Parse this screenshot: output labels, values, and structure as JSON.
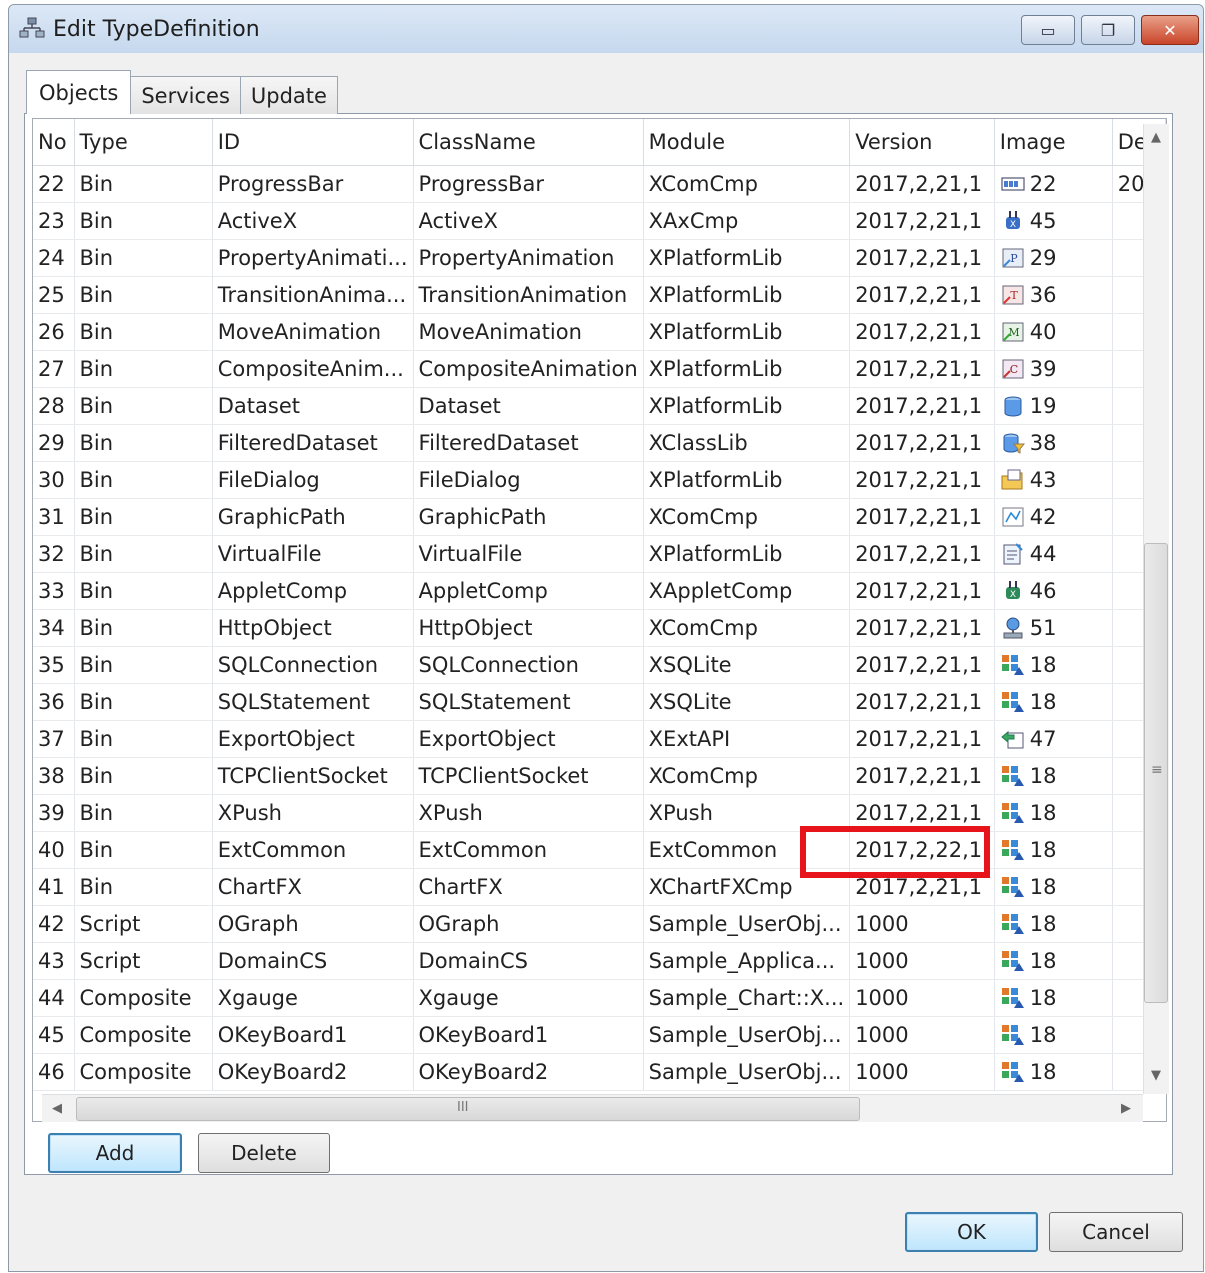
{
  "window": {
    "title": "Edit TypeDefinition",
    "accent": "#c9452a"
  },
  "tabs": [
    {
      "label": "Objects",
      "active": true
    },
    {
      "label": "Services",
      "active": false
    },
    {
      "label": "Update",
      "active": false
    }
  ],
  "grid": {
    "columns": [
      "No",
      "Type",
      "ID",
      "ClassName",
      "Module",
      "Version",
      "Image",
      "De"
    ],
    "rows": [
      {
        "no": "22",
        "type": "Bin",
        "id": "ProgressBar",
        "class": "ProgressBar",
        "module": "XComCmp",
        "version": "2017,2,21,1",
        "icon": "progressbar-icon",
        "image": "22",
        "de": "20"
      },
      {
        "no": "23",
        "type": "Bin",
        "id": "ActiveX",
        "class": "ActiveX",
        "module": "XAxCmp",
        "version": "2017,2,21,1",
        "icon": "activex-plug-icon",
        "image": "45",
        "de": ""
      },
      {
        "no": "24",
        "type": "Bin",
        "id": "PropertyAnimati...",
        "class": "PropertyAnimation",
        "module": "XPlatformLib",
        "version": "2017,2,21,1",
        "icon": "property-animation-icon",
        "image": "29",
        "de": ""
      },
      {
        "no": "25",
        "type": "Bin",
        "id": "TransitionAnima...",
        "class": "TransitionAnimation",
        "module": "XPlatformLib",
        "version": "2017,2,21,1",
        "icon": "transition-animation-icon",
        "image": "36",
        "de": ""
      },
      {
        "no": "26",
        "type": "Bin",
        "id": "MoveAnimation",
        "class": "MoveAnimation",
        "module": "XPlatformLib",
        "version": "2017,2,21,1",
        "icon": "move-animation-icon",
        "image": "40",
        "de": ""
      },
      {
        "no": "27",
        "type": "Bin",
        "id": "CompositeAnim...",
        "class": "CompositeAnimation",
        "module": "XPlatformLib",
        "version": "2017,2,21,1",
        "icon": "composite-animation-icon",
        "image": "39",
        "de": ""
      },
      {
        "no": "28",
        "type": "Bin",
        "id": "Dataset",
        "class": "Dataset",
        "module": "XPlatformLib",
        "version": "2017,2,21,1",
        "icon": "dataset-icon",
        "image": "19",
        "de": ""
      },
      {
        "no": "29",
        "type": "Bin",
        "id": "FilteredDataset",
        "class": "FilteredDataset",
        "module": "XClassLib",
        "version": "2017,2,21,1",
        "icon": "filtered-dataset-icon",
        "image": "38",
        "de": ""
      },
      {
        "no": "30",
        "type": "Bin",
        "id": "FileDialog",
        "class": "FileDialog",
        "module": "XPlatformLib",
        "version": "2017,2,21,1",
        "icon": "file-dialog-icon",
        "image": "43",
        "de": ""
      },
      {
        "no": "31",
        "type": "Bin",
        "id": "GraphicPath",
        "class": "GraphicPath",
        "module": "XComCmp",
        "version": "2017,2,21,1",
        "icon": "graphic-path-icon",
        "image": "42",
        "de": ""
      },
      {
        "no": "32",
        "type": "Bin",
        "id": "VirtualFile",
        "class": "VirtualFile",
        "module": "XPlatformLib",
        "version": "2017,2,21,1",
        "icon": "virtual-file-icon",
        "image": "44",
        "de": ""
      },
      {
        "no": "33",
        "type": "Bin",
        "id": "AppletComp",
        "class": "AppletComp",
        "module": "XAppletComp",
        "version": "2017,2,21,1",
        "icon": "applet-plug-icon",
        "image": "46",
        "de": ""
      },
      {
        "no": "34",
        "type": "Bin",
        "id": "HttpObject",
        "class": "HttpObject",
        "module": "XComCmp",
        "version": "2017,2,21,1",
        "icon": "http-object-icon",
        "image": "51",
        "de": ""
      },
      {
        "no": "35",
        "type": "Bin",
        "id": "SQLConnection",
        "class": "SQLConnection",
        "module": "XSQLite",
        "version": "2017,2,21,1",
        "icon": "component-icon",
        "image": "18",
        "de": ""
      },
      {
        "no": "36",
        "type": "Bin",
        "id": "SQLStatement",
        "class": "SQLStatement",
        "module": "XSQLite",
        "version": "2017,2,21,1",
        "icon": "component-icon",
        "image": "18",
        "de": ""
      },
      {
        "no": "37",
        "type": "Bin",
        "id": "ExportObject",
        "class": "ExportObject",
        "module": "XExtAPI",
        "version": "2017,2,21,1",
        "icon": "export-object-icon",
        "image": "47",
        "de": ""
      },
      {
        "no": "38",
        "type": "Bin",
        "id": "TCPClientSocket",
        "class": "TCPClientSocket",
        "module": "XComCmp",
        "version": "2017,2,21,1",
        "icon": "component-icon",
        "image": "18",
        "de": ""
      },
      {
        "no": "39",
        "type": "Bin",
        "id": "XPush",
        "class": "XPush",
        "module": "XPush",
        "version": "2017,2,21,1",
        "icon": "component-icon",
        "image": "18",
        "de": ""
      },
      {
        "no": "40",
        "type": "Bin",
        "id": "ExtCommon",
        "class": "ExtCommon",
        "module": "ExtCommon",
        "version": "2017,2,22,1",
        "icon": "component-icon",
        "image": "18",
        "de": ""
      },
      {
        "no": "41",
        "type": "Bin",
        "id": "ChartFX",
        "class": "ChartFX",
        "module": "XChartFXCmp",
        "version": "2017,2,21,1",
        "icon": "component-icon",
        "image": "18",
        "de": ""
      },
      {
        "no": "42",
        "type": "Script",
        "id": "OGraph",
        "class": "OGraph",
        "module": "Sample_UserObj...",
        "version": "1000",
        "icon": "component-icon",
        "image": "18",
        "de": ""
      },
      {
        "no": "43",
        "type": "Script",
        "id": "DomainCS",
        "class": "DomainCS",
        "module": "Sample_Applica...",
        "version": "1000",
        "icon": "component-icon",
        "image": "18",
        "de": ""
      },
      {
        "no": "44",
        "type": "Composite",
        "id": "Xgauge",
        "class": "Xgauge",
        "module": "Sample_Chart::X...",
        "version": "1000",
        "icon": "component-icon",
        "image": "18",
        "de": ""
      },
      {
        "no": "45",
        "type": "Composite",
        "id": "OKeyBoard1",
        "class": "OKeyBoard1",
        "module": "Sample_UserObj...",
        "version": "1000",
        "icon": "component-icon",
        "image": "18",
        "de": ""
      },
      {
        "no": "46",
        "type": "Composite",
        "id": "OKeyBoard2",
        "class": "OKeyBoard2",
        "module": "Sample_UserObj...",
        "version": "1000",
        "icon": "component-icon",
        "image": "18",
        "de": ""
      }
    ],
    "highlight_color": "#e8141b"
  },
  "scrollbar": {
    "h_thumb_glyph": "III",
    "v_thumb_glyph": "≡"
  },
  "buttons": {
    "add": "Add",
    "delete": "Delete",
    "ok": "OK",
    "cancel": "Cancel"
  }
}
